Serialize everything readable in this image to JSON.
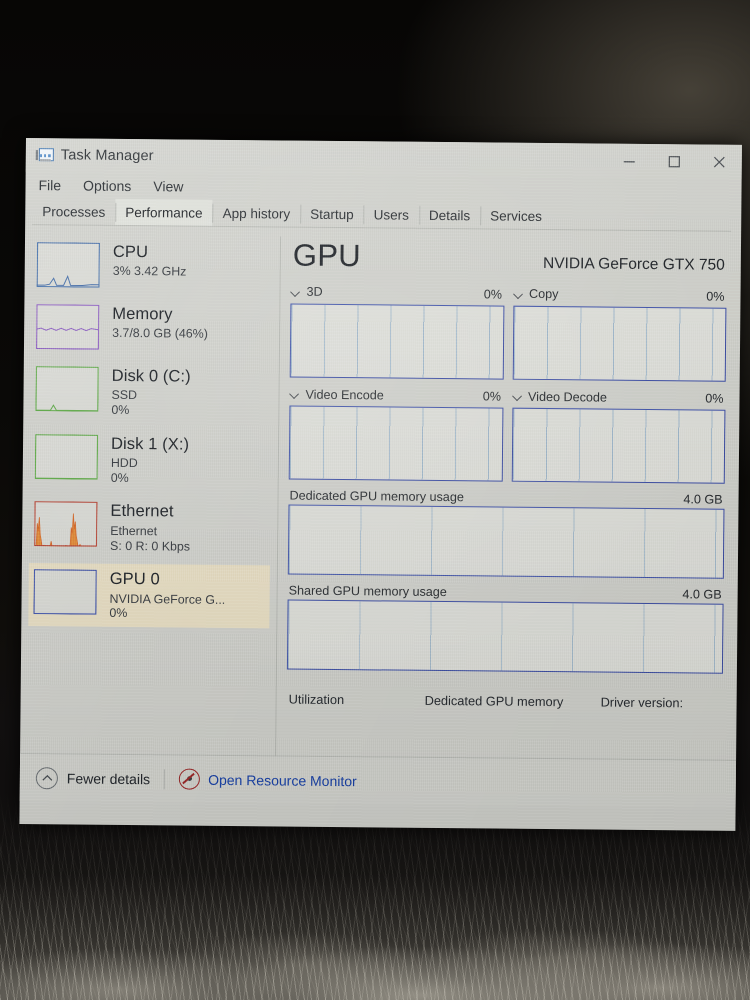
{
  "window": {
    "title": "Task Manager",
    "icon": "task-manager-icon",
    "controls": {
      "minimize": "—",
      "maximize": "□",
      "close": "✕"
    }
  },
  "menu": {
    "items": [
      "File",
      "Options",
      "View"
    ]
  },
  "tabs": {
    "active": "Performance",
    "items": [
      "Processes",
      "Performance",
      "App history",
      "Startup",
      "Users",
      "Details",
      "Services"
    ]
  },
  "sidebar": {
    "items": [
      {
        "name": "CPU",
        "sub": "3% 3.42 GHz",
        "sub2": "",
        "color": "#4a6fa8",
        "selected": false,
        "graph": "cpu"
      },
      {
        "name": "Memory",
        "sub": "3.7/8.0 GB (46%)",
        "sub2": "",
        "color": "#8a5fbf",
        "selected": false,
        "graph": "memory"
      },
      {
        "name": "Disk 0 (C:)",
        "sub": "SSD",
        "sub2": "0%",
        "color": "#5fa84a",
        "selected": false,
        "graph": "disk0"
      },
      {
        "name": "Disk 1 (X:)",
        "sub": "HDD",
        "sub2": "0%",
        "color": "#5fa84a",
        "selected": false,
        "graph": "disk1"
      },
      {
        "name": "Ethernet",
        "sub": "Ethernet",
        "sub2": "S: 0 R: 0 Kbps",
        "color": "#b5483a",
        "selected": false,
        "graph": "ethernet"
      },
      {
        "name": "GPU 0",
        "sub": "NVIDIA GeForce G...",
        "sub2": "0%",
        "color": "#4254a8",
        "selected": true,
        "graph": "gpu0"
      }
    ]
  },
  "main": {
    "heading": "GPU",
    "device": "NVIDIA GeForce GTX 750",
    "engines": [
      {
        "label": "3D",
        "value": "0%"
      },
      {
        "label": "Copy",
        "value": "0%"
      },
      {
        "label": "Video Encode",
        "value": "0%"
      },
      {
        "label": "Video Decode",
        "value": "0%"
      }
    ],
    "memory_graphs": [
      {
        "label": "Dedicated GPU memory usage",
        "max": "4.0 GB"
      },
      {
        "label": "Shared GPU memory usage",
        "max": "4.0 GB"
      }
    ],
    "stats": [
      {
        "label": "Utilization",
        "value": ""
      },
      {
        "label": "Dedicated GPU memory",
        "value": ""
      },
      {
        "label": "Driver version:",
        "value": ""
      }
    ]
  },
  "statusbar": {
    "fewer_details": "Fewer details",
    "open_resource_monitor": "Open Resource Monitor"
  },
  "colors": {
    "accent_blue": "#4254a8",
    "link_blue": "#1b44a8",
    "selected_row": "#e6ddc3",
    "window_bg": "#cfd0cb"
  },
  "chart_data": {
    "type": "line",
    "title": "GPU engine utilization and memory",
    "panels": [
      {
        "name": "3D",
        "ylim": [
          0,
          100
        ],
        "ylabel": "%",
        "values": [
          0,
          0,
          0,
          0,
          0,
          0,
          0,
          0,
          0,
          0
        ],
        "grid": true
      },
      {
        "name": "Copy",
        "ylim": [
          0,
          100
        ],
        "ylabel": "%",
        "values": [
          0,
          0,
          0,
          0,
          0,
          0,
          0,
          0,
          0,
          0
        ],
        "grid": true
      },
      {
        "name": "Video Encode",
        "ylim": [
          0,
          100
        ],
        "ylabel": "%",
        "values": [
          0,
          0,
          0,
          0,
          0,
          0,
          0,
          0,
          0,
          0
        ],
        "grid": true
      },
      {
        "name": "Video Decode",
        "ylim": [
          0,
          100
        ],
        "ylabel": "%",
        "values": [
          0,
          0,
          0,
          0,
          0,
          0,
          0,
          0,
          0,
          0
        ],
        "grid": true
      },
      {
        "name": "Dedicated GPU memory usage",
        "ylim": [
          0,
          4
        ],
        "ylabel": "GB",
        "values": [
          0,
          0,
          0,
          0,
          0,
          0,
          0,
          0,
          0,
          0
        ],
        "grid": true
      },
      {
        "name": "Shared GPU memory usage",
        "ylim": [
          0,
          4
        ],
        "ylabel": "GB",
        "values": [
          0,
          0,
          0,
          0,
          0,
          0,
          0,
          0,
          0,
          0
        ],
        "grid": true
      }
    ],
    "sidebar_sparklines": [
      {
        "name": "CPU",
        "ylim": [
          0,
          100
        ],
        "values": [
          1,
          1,
          1,
          2,
          1,
          1,
          9,
          2,
          1,
          12,
          2,
          1,
          1,
          2,
          1,
          1,
          2,
          1,
          3,
          1
        ]
      },
      {
        "name": "Memory",
        "ylim": [
          0,
          100
        ],
        "values": [
          46,
          46,
          47,
          46,
          46,
          47,
          46,
          46,
          46,
          47,
          46,
          46,
          47,
          46,
          46,
          46,
          47,
          46,
          46,
          46
        ]
      },
      {
        "name": "Disk 0",
        "ylim": [
          0,
          100
        ],
        "values": [
          0,
          0,
          0,
          0,
          6,
          0,
          0,
          0,
          0,
          0,
          0,
          0,
          0,
          0,
          0,
          0,
          0,
          0,
          0,
          0
        ]
      },
      {
        "name": "Disk 1",
        "ylim": [
          0,
          100
        ],
        "values": [
          0,
          0,
          0,
          0,
          0,
          0,
          0,
          0,
          0,
          0,
          0,
          0,
          0,
          0,
          0,
          0,
          0,
          0,
          0,
          0
        ]
      },
      {
        "name": "Ethernet",
        "ylim": [
          0,
          100
        ],
        "values": [
          0,
          55,
          30,
          70,
          10,
          5,
          2,
          0,
          8,
          2,
          0,
          0,
          0,
          60,
          35,
          80,
          45,
          20,
          5,
          0
        ]
      },
      {
        "name": "GPU 0",
        "ylim": [
          0,
          100
        ],
        "values": [
          0,
          0,
          0,
          0,
          0,
          0,
          0,
          0,
          0,
          0,
          0,
          0,
          0,
          0,
          0,
          0,
          0,
          0,
          0,
          0
        ]
      }
    ]
  }
}
